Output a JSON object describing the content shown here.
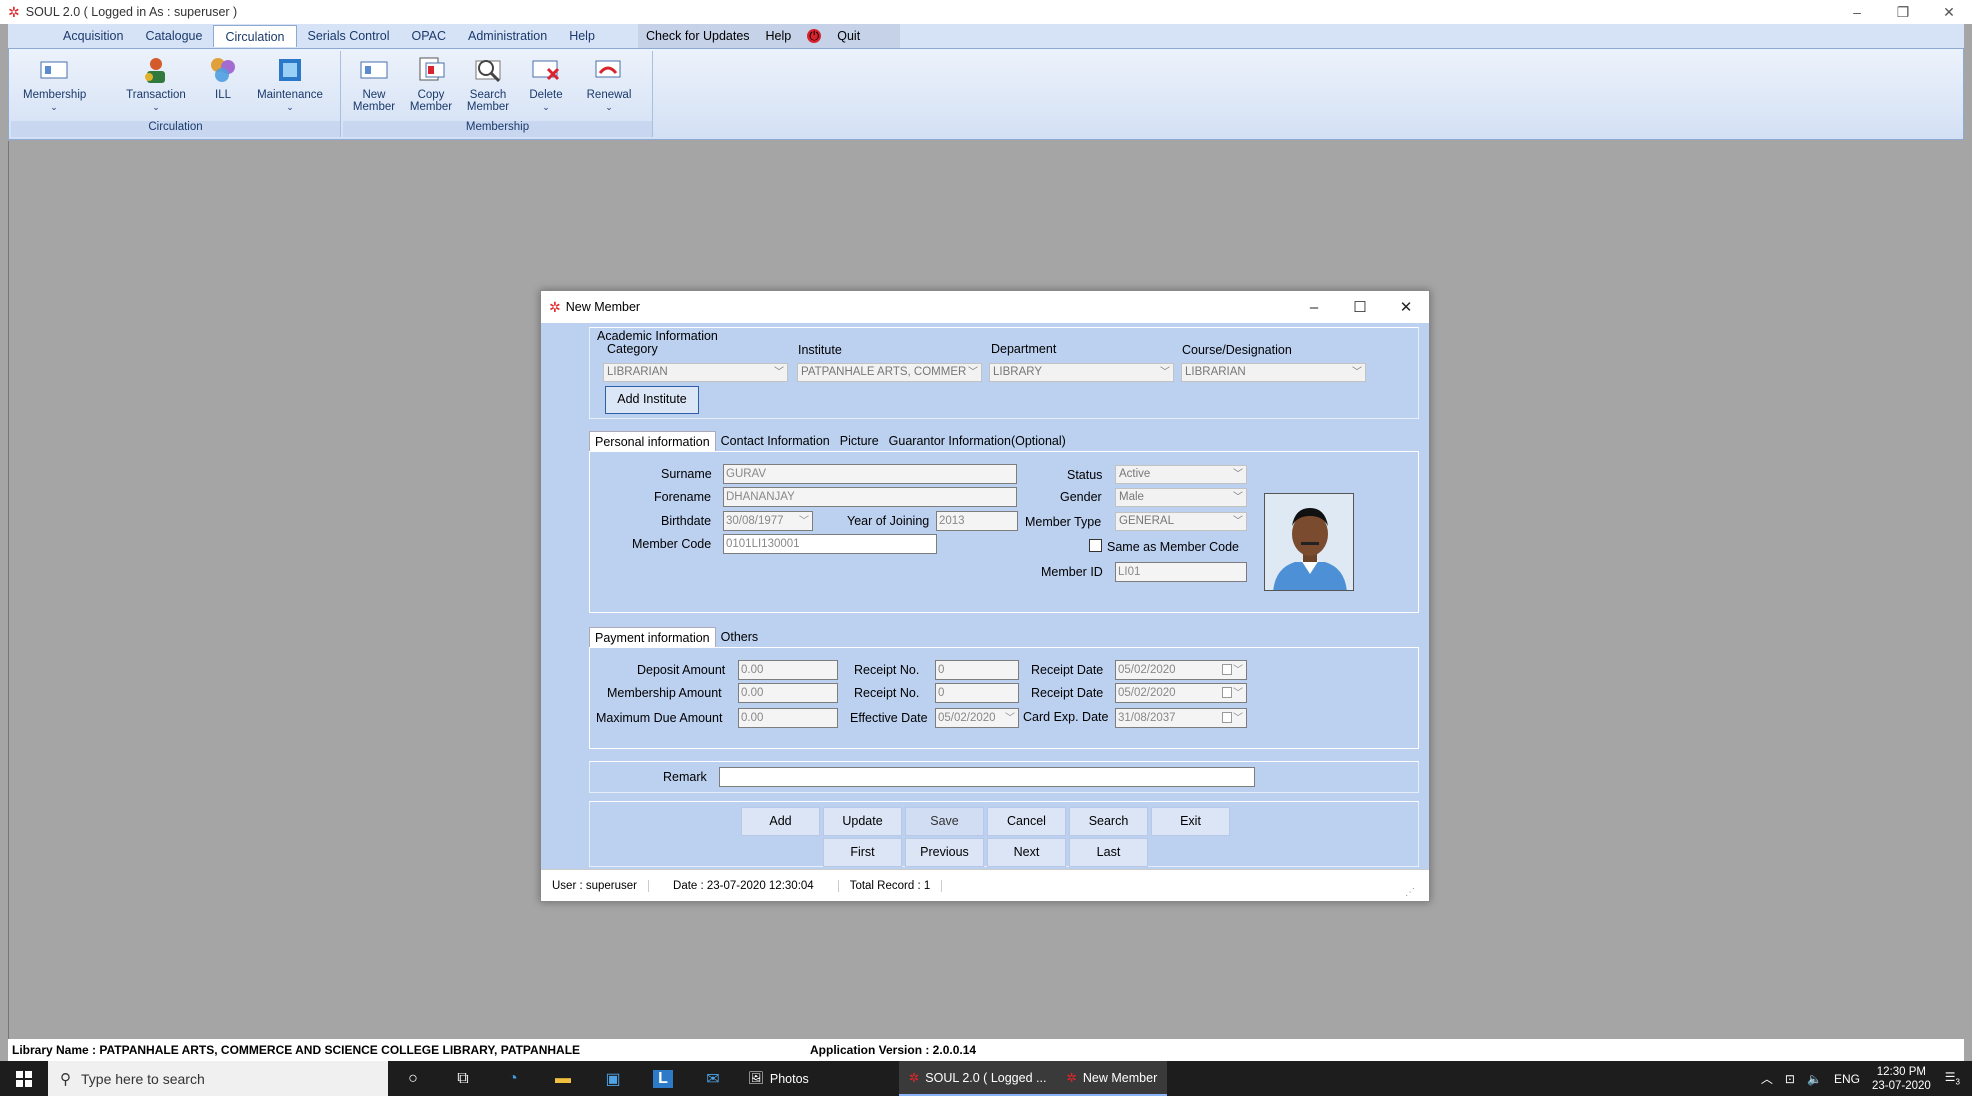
{
  "app": {
    "title": "SOUL 2.0  ( Logged in As : superuser )",
    "logo": "soul-logo"
  },
  "menu": {
    "tabs": [
      "Acquisition",
      "Catalogue",
      "Circulation",
      "Serials Control",
      "OPAC",
      "Administration",
      "Help"
    ],
    "active_tab": "Circulation",
    "extra": {
      "check_updates": "Check for Updates",
      "help": "Help",
      "quit": "Quit"
    }
  },
  "ribbon": {
    "groups": [
      {
        "label": "Circulation",
        "buttons": [
          "Membership",
          "Transaction",
          "ILL",
          "Maintenance"
        ]
      },
      {
        "label": "Membership",
        "buttons": [
          "New Member",
          "Copy Member",
          "Search Member",
          "Delete",
          "Renewal"
        ]
      }
    ],
    "labels": {
      "new_member_1": "New",
      "new_member_2": "Member",
      "copy_member_1": "Copy",
      "copy_member_2": "Member",
      "search_member_1": "Search",
      "search_member_2": "Member"
    }
  },
  "dialog": {
    "title": "New Member",
    "academic": {
      "heading": "Academic Information",
      "category_label": "Category",
      "category_value": "LIBRARIAN",
      "institute_label": "Institute",
      "institute_value": "PATPANHALE ARTS, COMMER",
      "department_label": "Department",
      "department_value": "LIBRARY",
      "course_label": "Course/Designation",
      "course_value": "LIBRARIAN",
      "add_institute": "Add Institute"
    },
    "personal_tabs": [
      "Personal information",
      "Contact Information",
      "Picture",
      "Guarantor Information(Optional)"
    ],
    "personal": {
      "surname_label": "Surname",
      "surname": "GURAV",
      "forename_label": "Forename",
      "forename": "DHANANJAY",
      "birthdate_label": "Birthdate",
      "birthdate": "30/08/1977",
      "year_joining_label": "Year of Joining",
      "year_joining": "2013",
      "member_code_label": "Member Code",
      "member_code": "0101LI130001",
      "status_label": "Status",
      "status": "Active",
      "gender_label": "Gender",
      "gender": "Male",
      "member_type_label": "Member Type",
      "member_type": "GENERAL",
      "same_as_code": "Same as Member Code",
      "member_id_label": "Member ID",
      "member_id": "LI01"
    },
    "payment_tabs": [
      "Payment information",
      "Others"
    ],
    "payment": {
      "deposit_label": "Deposit Amount",
      "deposit": "0.00",
      "membership_label": "Membership Amount",
      "membership": "0.00",
      "max_due_label": "Maximum Due Amount",
      "max_due": "0.00",
      "receipt_no_label": "Receipt No.",
      "receipt_no_1": "0",
      "receipt_no_2": "0",
      "effective_label": "Effective Date",
      "effective": "05/02/2020",
      "receipt_date_label": "Receipt Date",
      "receipt_date_1": "05/02/2020",
      "receipt_date_2": "05/02/2020",
      "card_exp_label": "Card Exp. Date",
      "card_exp": "31/08/2037"
    },
    "remark_label": "Remark",
    "remark": "",
    "buttons_row1": [
      "Add",
      "Update",
      "Save",
      "Cancel",
      "Search",
      "Exit"
    ],
    "buttons_row2": [
      "First",
      "Previous",
      "Next",
      "Last"
    ],
    "status": {
      "user": "User : superuser",
      "date": "Date : 23-07-2020 12:30:04",
      "total": "Total Record : 1"
    }
  },
  "footer": {
    "library": "Library Name : PATPANHALE ARTS, COMMERCE AND SCIENCE COLLEGE LIBRARY, PATPANHALE",
    "version": "Application Version : 2.0.0.14"
  },
  "taskbar": {
    "search_placeholder": "Type here to search",
    "apps": [
      "Photos",
      "SOUL 2.0  ( Logged ...",
      "New Member"
    ],
    "tray_lang": "ENG",
    "time": "12:30 PM",
    "date": "23-07-2020",
    "notif_count": "3"
  }
}
